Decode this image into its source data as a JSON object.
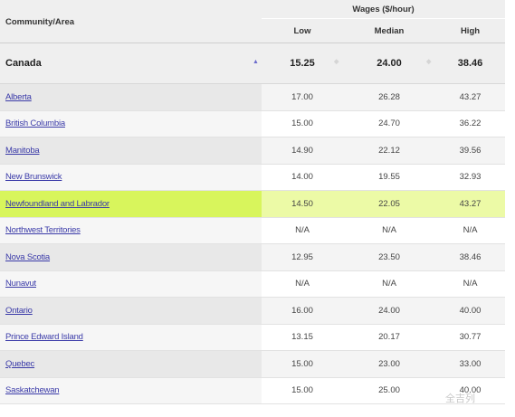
{
  "header": {
    "community": "Community/Area",
    "wages": "Wages ($/hour)",
    "low": "Low",
    "median": "Median",
    "high": "High"
  },
  "canada": {
    "name": "Canada",
    "low": "15.25",
    "median": "24.00",
    "high": "38.46"
  },
  "rows": [
    {
      "area": "Alberta",
      "low": "17.00",
      "median": "26.28",
      "high": "43.27"
    },
    {
      "area": "British Columbia",
      "low": "15.00",
      "median": "24.70",
      "high": "36.22"
    },
    {
      "area": "Manitoba",
      "low": "14.90",
      "median": "22.12",
      "high": "39.56"
    },
    {
      "area": "New Brunswick",
      "low": "14.00",
      "median": "19.55",
      "high": "32.93"
    },
    {
      "area": "Newfoundland and Labrador",
      "low": "14.50",
      "median": "22.05",
      "high": "43.27"
    },
    {
      "area": "Northwest Territories",
      "low": "N/A",
      "median": "N/A",
      "high": "N/A"
    },
    {
      "area": "Nova Scotia",
      "low": "12.95",
      "median": "23.50",
      "high": "38.46"
    },
    {
      "area": "Nunavut",
      "low": "N/A",
      "median": "N/A",
      "high": "N/A"
    },
    {
      "area": "Ontario",
      "low": "16.00",
      "median": "24.00",
      "high": "40.00"
    },
    {
      "area": "Prince Edward Island",
      "low": "13.15",
      "median": "20.17",
      "high": "30.77"
    },
    {
      "area": "Quebec",
      "low": "15.00",
      "median": "23.00",
      "high": "33.00"
    },
    {
      "area": "Saskatchewan",
      "low": "15.00",
      "median": "25.00",
      "high": "40.00"
    }
  ],
  "highlighted_area": "Newfoundland and Labrador",
  "watermark": "全吉列",
  "colors": {
    "highlight": "#d8f55c",
    "link": "#3a3aa8",
    "sort_active": "#6b6bcc"
  }
}
